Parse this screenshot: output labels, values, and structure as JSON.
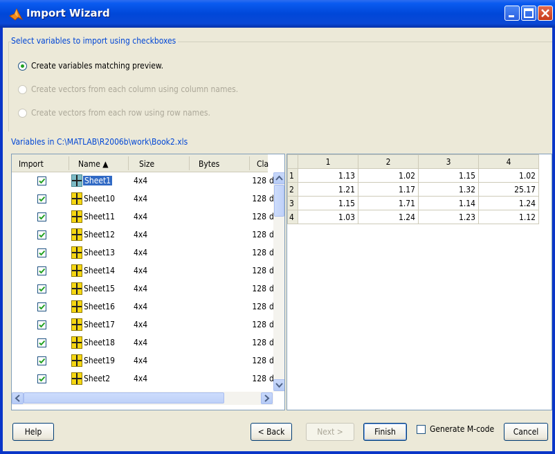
{
  "window": {
    "title": "Import Wizard"
  },
  "options": {
    "group_label": "Select variables to import using checkboxes",
    "radio_matching": "Create variables matching preview.",
    "radio_columns": "Create vectors from each column using column names.",
    "radio_rows": "Create vectors from each row using row names.",
    "selected": "matching"
  },
  "vars_label": "Variables in C:\\MATLAB\\R2006b\\work\\Book2.xls",
  "var_table": {
    "headers": {
      "import": "Import",
      "name": "Name ▲",
      "size": "Size",
      "bytes": "Bytes",
      "class": "Cla"
    },
    "rows": [
      {
        "name": "Sheet1",
        "size": "4x4",
        "bytes": "128",
        "class": "double",
        "checked": true,
        "selected": true
      },
      {
        "name": "Sheet10",
        "size": "4x4",
        "bytes": "128",
        "class": "double",
        "checked": true
      },
      {
        "name": "Sheet11",
        "size": "4x4",
        "bytes": "128",
        "class": "double",
        "checked": true
      },
      {
        "name": "Sheet12",
        "size": "4x4",
        "bytes": "128",
        "class": "double",
        "checked": true
      },
      {
        "name": "Sheet13",
        "size": "4x4",
        "bytes": "128",
        "class": "double",
        "checked": true
      },
      {
        "name": "Sheet14",
        "size": "4x4",
        "bytes": "128",
        "class": "double",
        "checked": true
      },
      {
        "name": "Sheet15",
        "size": "4x4",
        "bytes": "128",
        "class": "double",
        "checked": true
      },
      {
        "name": "Sheet16",
        "size": "4x4",
        "bytes": "128",
        "class": "double",
        "checked": true
      },
      {
        "name": "Sheet17",
        "size": "4x4",
        "bytes": "128",
        "class": "double",
        "checked": true
      },
      {
        "name": "Sheet18",
        "size": "4x4",
        "bytes": "128",
        "class": "double",
        "checked": true
      },
      {
        "name": "Sheet19",
        "size": "4x4",
        "bytes": "128",
        "class": "double",
        "checked": true
      },
      {
        "name": "Sheet2",
        "size": "4x4",
        "bytes": "128",
        "class": "double",
        "checked": true
      }
    ]
  },
  "preview": {
    "columns": [
      "1",
      "2",
      "3",
      "4"
    ],
    "rows": [
      {
        "label": "1",
        "values": [
          "1.13",
          "1.02",
          "1.15",
          "1.02"
        ]
      },
      {
        "label": "2",
        "values": [
          "1.21",
          "1.17",
          "1.32",
          "25.17"
        ]
      },
      {
        "label": "3",
        "values": [
          "1.15",
          "1.71",
          "1.14",
          "1.24"
        ]
      },
      {
        "label": "4",
        "values": [
          "1.03",
          "1.24",
          "1.23",
          "1.12"
        ]
      }
    ]
  },
  "buttons": {
    "help": "Help",
    "back": "< Back",
    "next": "Next >",
    "finish": "Finish",
    "generate_mcode": "Generate M-code",
    "cancel": "Cancel"
  },
  "colors": {
    "title_bar": "#0a48d6",
    "link_text": "#0046d5",
    "selection": "#316ac5"
  }
}
